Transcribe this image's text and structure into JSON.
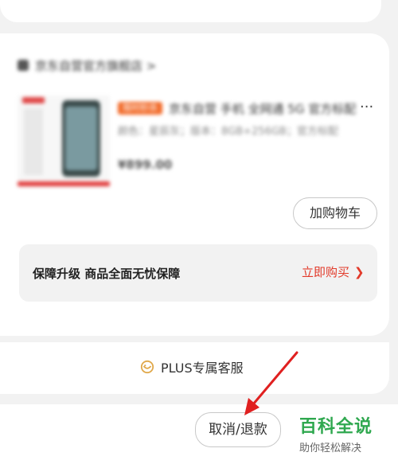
{
  "shop": {
    "name": "京东自营官方旗舰店 >"
  },
  "product": {
    "tag": "限时秒杀",
    "title": "京东自营 手机 全网通 5G 官方标配",
    "spec": "颜色：星辰灰；版本：8GB+256GB；官方标配",
    "price": "¥899.00",
    "more": "···"
  },
  "actions": {
    "add_to_cart": "加购物车"
  },
  "guarantee": {
    "text": "保障升级  商品全面无忧保障",
    "buy_now": "立即购买",
    "chevron": "❯"
  },
  "service": {
    "label": "PLUS专属客服",
    "icon": "customer-service-icon"
  },
  "bottom": {
    "cancel_refund": "取消/退款"
  },
  "watermark": {
    "title": "百科全说",
    "subtitle": "助你轻松解决"
  },
  "colors": {
    "accent_red": "#e23a2a",
    "brand_green": "#2fa84f",
    "arrow_red": "#e02020",
    "service_icon": "#e0a84a"
  }
}
